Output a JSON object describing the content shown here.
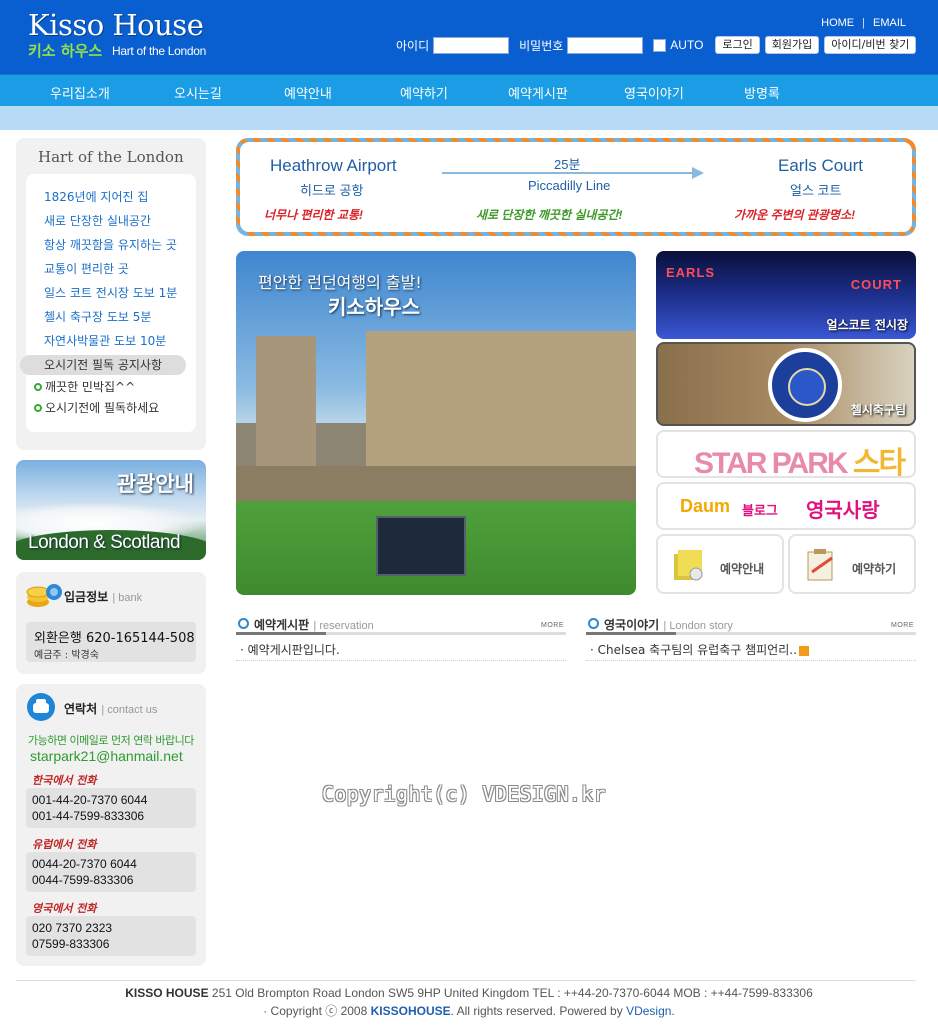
{
  "header": {
    "logo_en": "Kisso House",
    "logo_ko": "키소 하우스",
    "logo_sub": "Hart of the London",
    "top_links": [
      "HOME",
      "EMAIL"
    ],
    "login": {
      "id_label": "아이디",
      "pw_label": "비밀번호",
      "auto_label": "AUTO",
      "login_btn": "로그인",
      "join_btn": "회원가입",
      "find_btn": "아이디/비번 찾기"
    }
  },
  "nav": [
    "우리집소개",
    "오시는길",
    "예약안내",
    "예약하기",
    "예약게시판",
    "영국이야기",
    "방명록"
  ],
  "intro": {
    "title": "Hart of the London",
    "features": [
      "1826년에 지어진 집",
      "새로 단장한 실내공간",
      "항상 깨끗함을 유지하는 곳",
      "교통이 편리한 곳",
      "일스 코트 전시장 도보 1분",
      "첼시 축구장 도보 5분",
      "자연사박물관 도보 10분"
    ],
    "notice_title": "오시기전 필독 공지사항",
    "notices": [
      "깨끗한 민박집^^",
      "오시기전에 필독하세요"
    ]
  },
  "tour": {
    "title": "관광안내",
    "subtitle": "London & Scotland"
  },
  "bank": {
    "title": "입금정보",
    "title_en": "bank",
    "account": "외환은행 620-165144-508",
    "holder": "예금주 : 박경숙"
  },
  "contact": {
    "title": "연락처",
    "title_en": "contact us",
    "note": "가능하면 이메일로 먼저 연락 바랍니다",
    "email": "starpark21@hanmail.net",
    "groups": [
      {
        "label": "한국에서 전화",
        "lines": [
          "001-44-20-7370 6044",
          "001-44-7599-833306"
        ]
      },
      {
        "label": "유럽에서 전화",
        "lines": [
          "0044-20-7370 6044",
          "0044-7599-833306"
        ]
      },
      {
        "label": "영국에서 전화",
        "lines": [
          "020 7370 2323",
          "07599-833306"
        ]
      }
    ]
  },
  "route": {
    "from_en": "Heathrow Airport",
    "from_ko": "히드로 공항",
    "duration": "25분",
    "line": "Piccadilly Line",
    "to_en": "Earls Court",
    "to_ko": "얼스 코트",
    "slogan1": "너무나 편리한 교통!",
    "slogan2": "새로 단장한 깨끗한 실내공간!",
    "slogan3": "가까운 주변의 관광명소!",
    "colors": {
      "slogan1": "#d8262a",
      "slogan2": "#3f9a2a",
      "slogan3": "#d8262a"
    }
  },
  "main_photo": {
    "line1": "편안한 런던여행의 출발!",
    "line2": "키소하우스"
  },
  "side_banners": {
    "earls_neon1": "EARLS",
    "earls_neon2": "COURT",
    "earls": "얼스코트 전시장",
    "chelsea": "첼시축구팀",
    "starpark_a": "STAR PARK",
    "starpark_b": "스타박",
    "blog_daum": "Daum",
    "blog_label": "블로그",
    "blog_title": "영국사랑",
    "reserve_info": "예약안내",
    "reserve_do": "예약하기"
  },
  "boards": {
    "reservation": {
      "title": "예약게시판",
      "title_en": "reservation",
      "more": "MORE",
      "items": [
        "예약게시판입니다."
      ]
    },
    "story": {
      "title": "영국이야기",
      "title_en": "London story",
      "more": "MORE",
      "items": [
        "Chelsea 축구팀의 유럽축구 챔피언리.."
      ]
    }
  },
  "watermark": "Copyright(c) VDESIGN.kr",
  "footer": {
    "brand": "KISSO HOUSE",
    "address": "251 Old Brompton Road London SW5 9HP United Kingdom TEL : ++44-20-7370-6044 MOB : ++44-7599-833306",
    "copy_prefix": "· Copyright ⓒ 2008",
    "copy_brand": "KISSOHOUSE",
    "copy_suffix": ". All rights reserved. Powered by",
    "powered": "VDesign",
    "copy_end": "."
  }
}
